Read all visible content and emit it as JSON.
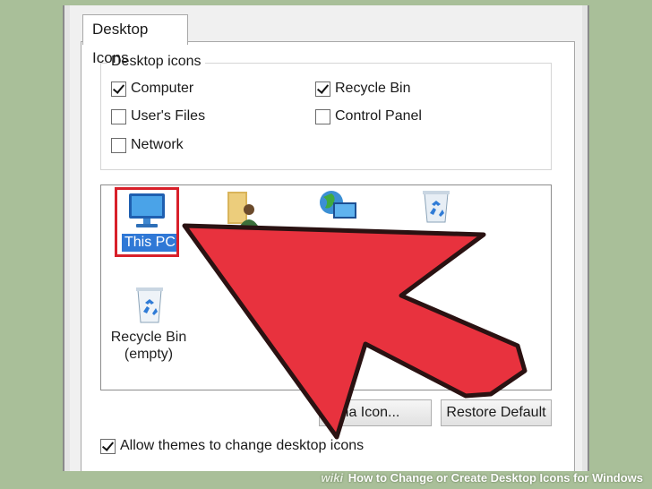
{
  "tab": {
    "label": "Desktop Icons"
  },
  "group": {
    "title": "Desktop icons",
    "checkboxes": [
      {
        "label": "Computer",
        "checked": true
      },
      {
        "label": "User's Files",
        "checked": false
      },
      {
        "label": "Network",
        "checked": false
      },
      {
        "label": "Recycle Bin",
        "checked": true
      },
      {
        "label": "Control Panel",
        "checked": false
      }
    ]
  },
  "icons": [
    {
      "name": "this-pc-icon",
      "label": "This PC",
      "selected": true
    },
    {
      "name": "user-files-icon",
      "label": ""
    },
    {
      "name": "network-icon",
      "label": ""
    },
    {
      "name": "recycle-bin-full-icon",
      "label": ""
    },
    {
      "name": "recycle-bin-empty-icon",
      "label": "Recycle Bin (empty)"
    }
  ],
  "recycle_label_line1": "Recycle Bin",
  "recycle_label_line2": "(empty)",
  "buttons": {
    "change_icon": "Change Icon...",
    "change_icon_visible": "Cha       Icon...",
    "restore_default": "Restore Default"
  },
  "allow_themes": {
    "label": "Allow themes to change desktop icons",
    "checked": true
  },
  "footer": {
    "wiki": "wiki",
    "text": "How to Change or Create Desktop Icons for Windows"
  },
  "colors": {
    "arrow": "#e8323e",
    "selection": "#2f78d6",
    "highlight_box": "#d8202a",
    "background": "#a9bf99"
  }
}
